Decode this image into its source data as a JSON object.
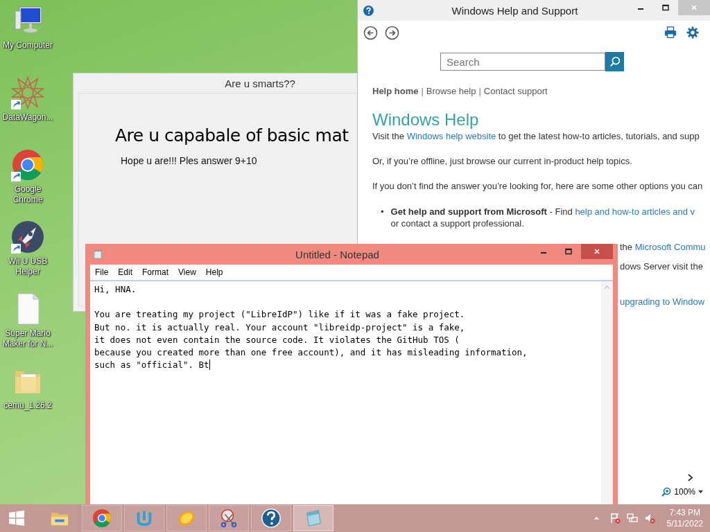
{
  "desktop_icons": [
    {
      "kind": "computer",
      "label": "My Computer",
      "shortcut": false
    },
    {
      "kind": "star",
      "label": "DataWagon...",
      "shortcut": true
    },
    {
      "kind": "chrome",
      "label": "Google Chrome",
      "shortcut": true
    },
    {
      "kind": "rocket",
      "label": "Wii U USB Helper",
      "shortcut": true
    },
    {
      "kind": "file",
      "label": "Super Mario Maker for N...",
      "shortcut": false
    },
    {
      "kind": "folder",
      "label": "cemu_1.26.2",
      "shortcut": false
    }
  ],
  "quiz_window": {
    "title": "Are u smarts??",
    "heading": "Are u capabale of basic mat",
    "text": "Hope u are!!! Ples answer 9+10"
  },
  "help_window": {
    "title": "Windows Help and Support",
    "search": {
      "placeholder": "Search"
    },
    "nav": [
      {
        "label": "Help home",
        "selected": true
      },
      {
        "label": "Browse help",
        "selected": false,
        "separator": "|"
      },
      {
        "label": "Contact support",
        "selected": false,
        "separator": "|"
      }
    ],
    "heading": "Windows Help",
    "paragraphs": [
      {
        "kind": "link",
        "before": "Visit the ",
        "link": "Windows help website",
        "after": " to get the latest how-to articles, tutorials, and supp"
      },
      {
        "kind": "plain",
        "text": "Or, if you’re offline, just browse our current in-product help topics."
      },
      {
        "kind": "plain",
        "text": "If you don’t find the answer you’re looking for, here are some other options you can"
      },
      {
        "kind": "bullet",
        "bullet": "•",
        "text": "**Get help and support from Microsoft** - Find ",
        "link": "help and how-to articles and v",
        "continuation": "or contact a support professional."
      }
    ],
    "covered_rows": [
      [
        {
          "kind": "text",
          "text": "the "
        },
        {
          "kind": "link",
          "text": "Microsoft Commu"
        }
      ],
      [
        {
          "kind": "text",
          "text": "dows Server visit the"
        }
      ],
      [
        {
          "kind": "link",
          "text": "upgrading to Window"
        }
      ]
    ],
    "zoom": "100%"
  },
  "notepad": {
    "title": "Untitled - Notepad",
    "menu": [
      "File",
      "Edit",
      "Format",
      "View",
      "Help"
    ],
    "text": "Hi, HNA.\n\nYou are treating my project (\"LibreIdP\") like if it was a fake project.\nBut no. it is actually real. Your account \"libreidp-project\" is a fake,\nit does not even contain the source code. It violates the GitHub TOS (\nbecause you created more than one free account), and it has misleading information,\nsuch as \"official\". Bt"
  },
  "taskbar": {
    "items": [
      {
        "kind": "explorer",
        "running": false,
        "selected": false
      },
      {
        "kind": "chrome",
        "running": true,
        "selected": false
      },
      {
        "kind": "usb",
        "running": true,
        "selected": false
      },
      {
        "kind": "citrus",
        "running": true,
        "selected": false
      },
      {
        "kind": "scissors",
        "running": true,
        "selected": false
      },
      {
        "kind": "help",
        "running": true,
        "selected": false
      },
      {
        "kind": "notepad",
        "running": true,
        "selected": true
      }
    ],
    "time": "7:43 PM",
    "date": "5/11/2022"
  }
}
